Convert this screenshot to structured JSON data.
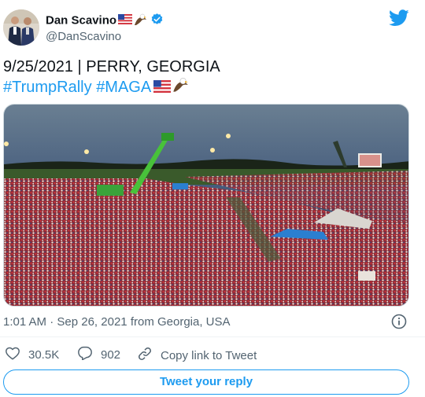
{
  "author": {
    "name": "Dan Scavino",
    "handle": "@DanScavino",
    "flag_emoji": "🇺🇸",
    "eagle_emoji": "🦅",
    "verified": true,
    "avatar_icon": "profile-photo"
  },
  "tweet": {
    "line1": "9/25/2021 | PERRY, GEORGIA",
    "hashtags": [
      "#TrumpRally",
      "#MAGA"
    ],
    "trailing_flag": "🇺🇸",
    "trailing_eagle": "🦅"
  },
  "meta": {
    "time": "1:01 AM",
    "separator": "·",
    "date": "Sep 26, 2021",
    "location": "from Georgia, USA"
  },
  "actions": {
    "likes": "30.5K",
    "replies": "902",
    "copy_link": "Copy link to Tweet"
  },
  "reply_button": "Tweet your reply",
  "colors": {
    "accent": "#1d9bf0",
    "text": "#0f1419",
    "secondary": "#536471",
    "border": "#eff3f4"
  },
  "icons": [
    "twitter-bird-icon",
    "verified-badge-icon",
    "info-icon",
    "heart-icon",
    "reply-icon",
    "link-icon"
  ]
}
